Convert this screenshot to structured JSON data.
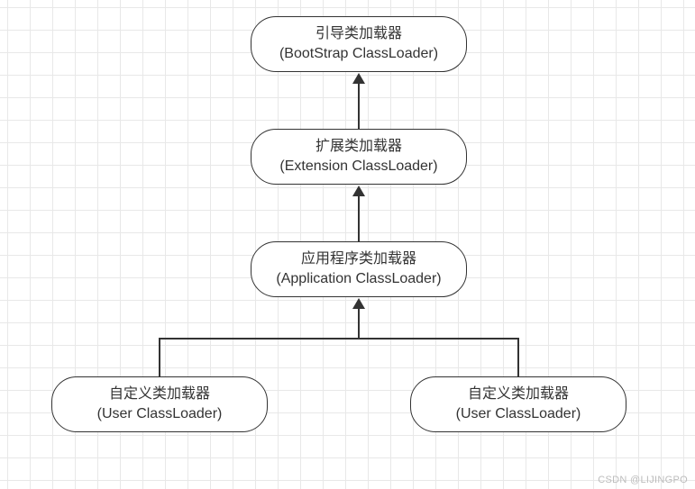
{
  "nodes": {
    "bootstrap": {
      "line1": "引导类加载器",
      "line2": "(BootStrap ClassLoader)"
    },
    "extension": {
      "line1": "扩展类加载器",
      "line2": "(Extension ClassLoader)"
    },
    "application": {
      "line1": "应用程序类加载器",
      "line2": "(Application ClassLoader)"
    },
    "user_left": {
      "line1": "自定义类加载器",
      "line2": "(User ClassLoader)"
    },
    "user_right": {
      "line1": "自定义类加载器",
      "line2": "(User ClassLoader)"
    }
  },
  "watermark": "CSDN @LIJINGPO"
}
